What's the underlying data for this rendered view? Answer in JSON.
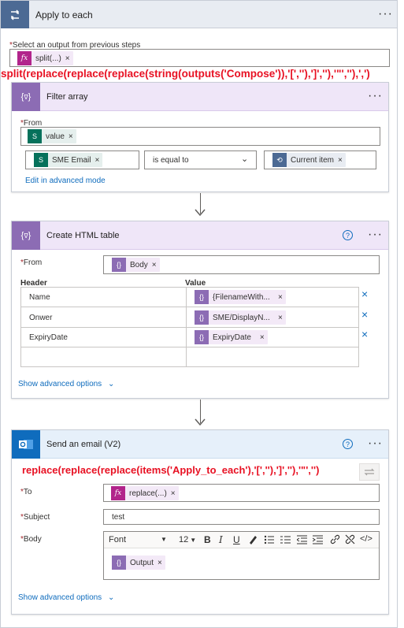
{
  "apply_to_each": {
    "title": "Apply to each",
    "select_label": "Select an output from previous steps",
    "select_token": "split(...)",
    "expression": "split(replace(replace(replace(string(outputs('Compose')),'[',''),']',''),'\"',''),',')"
  },
  "filter_array": {
    "title": "Filter array",
    "from_label": "From",
    "from_token": "value",
    "left_token": "SME Email",
    "operator": "is equal to",
    "right_token": "Current item",
    "advanced_link": "Edit in advanced mode"
  },
  "create_html_table": {
    "title": "Create HTML table",
    "from_label": "From",
    "from_token": "Body",
    "header_col": "Header",
    "value_col": "Value",
    "rows": [
      {
        "header": "Name",
        "value": "{FilenameWith..."
      },
      {
        "header": "Onwer",
        "value": "SME/DisplayN..."
      },
      {
        "header": "ExpiryDate",
        "value": "ExpiryDate"
      },
      {
        "header": "",
        "value": ""
      }
    ],
    "advanced_link": "Show advanced options"
  },
  "send_email": {
    "title": "Send an email (V2)",
    "expression": "replace(replace(replace(items('Apply_to_each'),'[',''),']',''),'\"','')",
    "to_label": "To",
    "to_token": "replace(...)",
    "subject_label": "Subject",
    "subject_value": "test",
    "body_label": "Body",
    "font_value": "Font",
    "font_size": "12",
    "body_token": "Output",
    "advanced_link": "Show advanced options"
  },
  "icons": {
    "fx": "fx",
    "x": "×",
    "more": "···",
    "help": "?",
    "chevron": "⌄"
  },
  "colors": {
    "loop_accent": "#4c6a94",
    "data_op_accent": "#8c6cb4",
    "outlook_accent": "#0f6cbd",
    "expression_red": "#e81123"
  }
}
